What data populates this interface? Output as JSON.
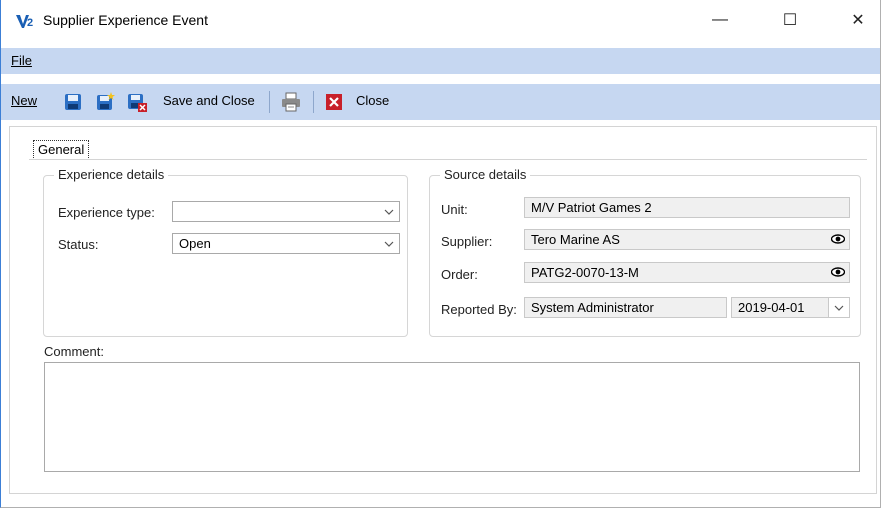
{
  "window": {
    "title": "Supplier Experience Event",
    "minimize": "—",
    "maximize": "☐",
    "close": "✕"
  },
  "menu": {
    "file": "File"
  },
  "toolbar": {
    "new_label": "New",
    "save_close_label": "Save and Close",
    "close_label": "Close"
  },
  "tabs": [
    {
      "label": "General"
    }
  ],
  "experience": {
    "group_label": "Experience details",
    "type_label": "Experience type:",
    "type_value": "",
    "status_label": "Status:",
    "status_value": "Open"
  },
  "source": {
    "group_label": "Source details",
    "unit_label": "Unit:",
    "unit_value": "M/V Patriot Games 2",
    "supplier_label": "Supplier:",
    "supplier_value": "Tero Marine AS",
    "order_label": "Order:",
    "order_value": "PATG2-0070-13-M",
    "reported_by_label": "Reported By:",
    "reported_by_value": "System Administrator",
    "reported_date_value": "2019-04-01"
  },
  "comment": {
    "label": "Comment:",
    "value": ""
  }
}
